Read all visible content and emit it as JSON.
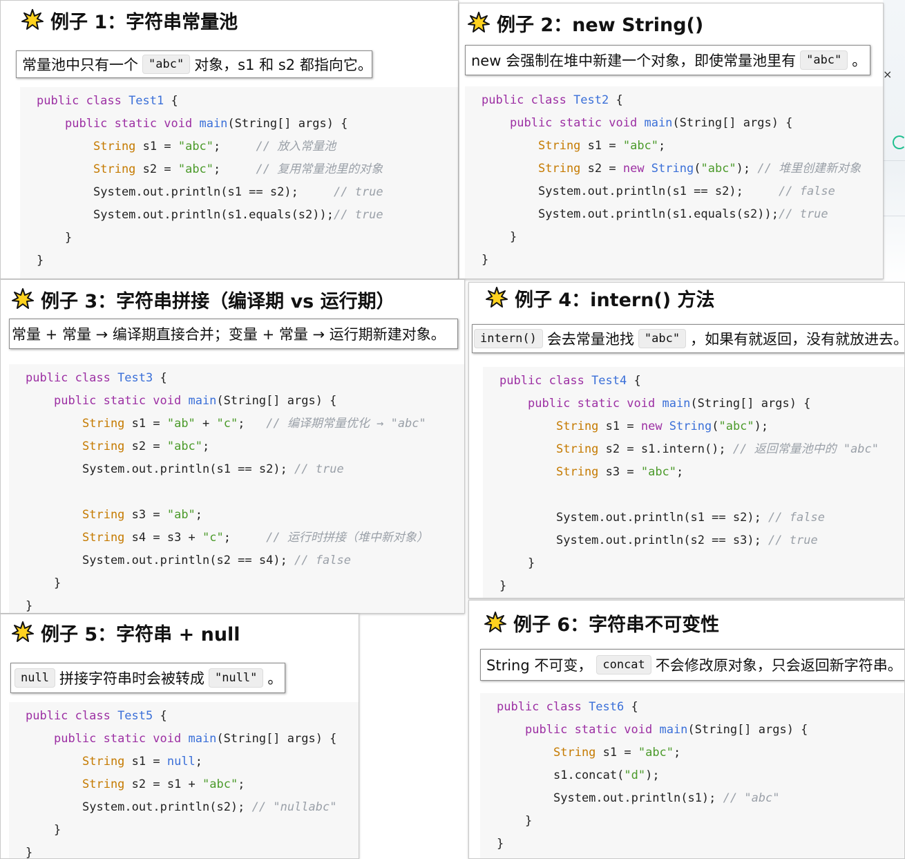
{
  "icon": "star-icon",
  "colors": {
    "keyword": "#9c2fa3",
    "type": "#c57a00",
    "function": "#3a6fd8",
    "string": "#4b9a2a",
    "comment": "#9aa0a8"
  },
  "examples": [
    {
      "title": "例子 1：字符串常量池",
      "note": {
        "pre": "常量池中只有一个",
        "chip": "\"abc\"",
        "post": "对象，s1 和 s2 都指向它。"
      },
      "code": [
        {
          "i": 0,
          "p": [
            [
              "k",
              "public class "
            ],
            [
              "f",
              "Test1"
            ],
            [
              "d",
              " {"
            ]
          ]
        },
        {
          "i": 1,
          "p": [
            [
              "k",
              "public static void "
            ],
            [
              "f",
              "main"
            ],
            [
              "d",
              "(String[] args) {"
            ]
          ]
        },
        {
          "i": 2,
          "p": [
            [
              "t",
              "String"
            ],
            [
              "d",
              " s1 = "
            ],
            [
              "s",
              "\"abc\""
            ],
            [
              "d",
              ";     "
            ],
            [
              "c",
              "// 放入常量池"
            ]
          ]
        },
        {
          "i": 2,
          "p": [
            [
              "t",
              "String"
            ],
            [
              "d",
              " s2 = "
            ],
            [
              "s",
              "\"abc\""
            ],
            [
              "d",
              ";     "
            ],
            [
              "c",
              "// 复用常量池里的对象"
            ]
          ]
        },
        {
          "i": 2,
          "p": [
            [
              "d",
              "System.out.println(s1 == s2);     "
            ],
            [
              "c",
              "// true"
            ]
          ]
        },
        {
          "i": 2,
          "p": [
            [
              "d",
              "System.out.println(s1.equals(s2));"
            ],
            [
              "c",
              "// true"
            ]
          ]
        },
        {
          "i": 1,
          "p": [
            [
              "d",
              "}"
            ]
          ]
        },
        {
          "i": 0,
          "p": [
            [
              "d",
              "}"
            ]
          ]
        }
      ]
    },
    {
      "title": "例子 2：new String()",
      "note": {
        "pre": "new 会强制在堆中新建一个对象，即使常量池里有",
        "chip": "\"abc\"",
        "post": "。"
      },
      "code": [
        {
          "i": 0,
          "p": [
            [
              "k",
              "public class "
            ],
            [
              "f",
              "Test2"
            ],
            [
              "d",
              " {"
            ]
          ]
        },
        {
          "i": 1,
          "p": [
            [
              "k",
              "public static void "
            ],
            [
              "f",
              "main"
            ],
            [
              "d",
              "(String[] args) {"
            ]
          ]
        },
        {
          "i": 2,
          "p": [
            [
              "t",
              "String"
            ],
            [
              "d",
              " s1 = "
            ],
            [
              "s",
              "\"abc\""
            ],
            [
              "d",
              ";"
            ]
          ]
        },
        {
          "i": 2,
          "p": [
            [
              "t",
              "String"
            ],
            [
              "d",
              " s2 = "
            ],
            [
              "k",
              "new "
            ],
            [
              "f",
              "String"
            ],
            [
              "d",
              "("
            ],
            [
              "s",
              "\"abc\""
            ],
            [
              "d",
              "); "
            ],
            [
              "c",
              "// 堆里创建新对象"
            ]
          ]
        },
        {
          "i": 2,
          "p": [
            [
              "d",
              "System.out.println(s1 == s2);     "
            ],
            [
              "c",
              "// false"
            ]
          ]
        },
        {
          "i": 2,
          "p": [
            [
              "d",
              "System.out.println(s1.equals(s2));"
            ],
            [
              "c",
              "// true"
            ]
          ]
        },
        {
          "i": 1,
          "p": [
            [
              "d",
              "}"
            ]
          ]
        },
        {
          "i": 0,
          "p": [
            [
              "d",
              "}"
            ]
          ]
        }
      ]
    },
    {
      "title": "例子 3：字符串拼接（编译期 vs 运行期）",
      "note": {
        "pre": "常量 + 常量 → 编译期直接合并；变量 + 常量 → 运行期新建对象。",
        "chip": "",
        "post": ""
      },
      "code": [
        {
          "i": 0,
          "p": [
            [
              "k",
              "public class "
            ],
            [
              "f",
              "Test3"
            ],
            [
              "d",
              " {"
            ]
          ]
        },
        {
          "i": 1,
          "p": [
            [
              "k",
              "public static void "
            ],
            [
              "f",
              "main"
            ],
            [
              "d",
              "(String[] args) {"
            ]
          ]
        },
        {
          "i": 2,
          "p": [
            [
              "t",
              "String"
            ],
            [
              "d",
              " s1 = "
            ],
            [
              "s",
              "\"ab\""
            ],
            [
              "d",
              " + "
            ],
            [
              "s",
              "\"c\""
            ],
            [
              "d",
              ";   "
            ],
            [
              "c",
              "// 编译期常量优化 → \"abc\""
            ]
          ]
        },
        {
          "i": 2,
          "p": [
            [
              "t",
              "String"
            ],
            [
              "d",
              " s2 = "
            ],
            [
              "s",
              "\"abc\""
            ],
            [
              "d",
              ";"
            ]
          ]
        },
        {
          "i": 2,
          "p": [
            [
              "d",
              "System.out.println(s1 == s2); "
            ],
            [
              "c",
              "// true"
            ]
          ]
        },
        {
          "i": 2,
          "p": [
            [
              "d",
              ""
            ]
          ]
        },
        {
          "i": 2,
          "p": [
            [
              "t",
              "String"
            ],
            [
              "d",
              " s3 = "
            ],
            [
              "s",
              "\"ab\""
            ],
            [
              "d",
              ";"
            ]
          ]
        },
        {
          "i": 2,
          "p": [
            [
              "t",
              "String"
            ],
            [
              "d",
              " s4 = s3 + "
            ],
            [
              "s",
              "\"c\""
            ],
            [
              "d",
              ";     "
            ],
            [
              "c",
              "// 运行时拼接（堆中新对象）"
            ]
          ]
        },
        {
          "i": 2,
          "p": [
            [
              "d",
              "System.out.println(s2 == s4); "
            ],
            [
              "c",
              "// false"
            ]
          ]
        },
        {
          "i": 1,
          "p": [
            [
              "d",
              "}"
            ]
          ]
        },
        {
          "i": 0,
          "p": [
            [
              "d",
              "}"
            ]
          ]
        }
      ]
    },
    {
      "title": "例子 4：intern() 方法",
      "note": {
        "chip0": "intern()",
        "pre": "会去常量池找",
        "chip": "\"abc\"",
        "post": "，如果有就返回，没有就放进去。"
      },
      "code": [
        {
          "i": 0,
          "p": [
            [
              "k",
              "public class "
            ],
            [
              "f",
              "Test4"
            ],
            [
              "d",
              " {"
            ]
          ]
        },
        {
          "i": 1,
          "p": [
            [
              "k",
              "public static void "
            ],
            [
              "f",
              "main"
            ],
            [
              "d",
              "(String[] args) {"
            ]
          ]
        },
        {
          "i": 2,
          "p": [
            [
              "t",
              "String"
            ],
            [
              "d",
              " s1 = "
            ],
            [
              "k",
              "new "
            ],
            [
              "f",
              "String"
            ],
            [
              "d",
              "("
            ],
            [
              "s",
              "\"abc\""
            ],
            [
              "d",
              ");"
            ]
          ]
        },
        {
          "i": 2,
          "p": [
            [
              "t",
              "String"
            ],
            [
              "d",
              " s2 = s1.intern(); "
            ],
            [
              "c",
              "// 返回常量池中的 \"abc\""
            ]
          ]
        },
        {
          "i": 2,
          "p": [
            [
              "t",
              "String"
            ],
            [
              "d",
              " s3 = "
            ],
            [
              "s",
              "\"abc\""
            ],
            [
              "d",
              ";"
            ]
          ]
        },
        {
          "i": 2,
          "p": [
            [
              "d",
              ""
            ]
          ]
        },
        {
          "i": 2,
          "p": [
            [
              "d",
              "System.out.println(s1 == s2); "
            ],
            [
              "c",
              "// false"
            ]
          ]
        },
        {
          "i": 2,
          "p": [
            [
              "d",
              "System.out.println(s2 == s3); "
            ],
            [
              "c",
              "// true"
            ]
          ]
        },
        {
          "i": 1,
          "p": [
            [
              "d",
              "}"
            ]
          ]
        },
        {
          "i": 0,
          "p": [
            [
              "d",
              "}"
            ]
          ]
        }
      ]
    },
    {
      "title": "例子 5：字符串 + null",
      "note": {
        "chip0": "null",
        "pre": "拼接字符串时会被转成",
        "chip": "\"null\"",
        "post": "。"
      },
      "code": [
        {
          "i": 0,
          "p": [
            [
              "k",
              "public class "
            ],
            [
              "f",
              "Test5"
            ],
            [
              "d",
              " {"
            ]
          ]
        },
        {
          "i": 1,
          "p": [
            [
              "k",
              "public static void "
            ],
            [
              "f",
              "main"
            ],
            [
              "d",
              "(String[] args) {"
            ]
          ]
        },
        {
          "i": 2,
          "p": [
            [
              "t",
              "String"
            ],
            [
              "d",
              " s1 = "
            ],
            [
              "f",
              "null"
            ],
            [
              "d",
              ";"
            ]
          ]
        },
        {
          "i": 2,
          "p": [
            [
              "t",
              "String"
            ],
            [
              "d",
              " s2 = s1 + "
            ],
            [
              "s",
              "\"abc\""
            ],
            [
              "d",
              ";"
            ]
          ]
        },
        {
          "i": 2,
          "p": [
            [
              "d",
              "System.out.println(s2); "
            ],
            [
              "c",
              "// \"nullabc\""
            ]
          ]
        },
        {
          "i": 1,
          "p": [
            [
              "d",
              "}"
            ]
          ]
        },
        {
          "i": 0,
          "p": [
            [
              "d",
              "}"
            ]
          ]
        }
      ]
    },
    {
      "title": "例子 6：字符串不可变性",
      "note": {
        "pre": "String 不可变，",
        "chip": "concat",
        "post": "不会修改原对象，只会返回新字符串。"
      },
      "code": [
        {
          "i": 0,
          "p": [
            [
              "k",
              "public class "
            ],
            [
              "f",
              "Test6"
            ],
            [
              "d",
              " {"
            ]
          ]
        },
        {
          "i": 1,
          "p": [
            [
              "k",
              "public static void "
            ],
            [
              "f",
              "main"
            ],
            [
              "d",
              "(String[] args) {"
            ]
          ]
        },
        {
          "i": 2,
          "p": [
            [
              "t",
              "String"
            ],
            [
              "d",
              " s1 = "
            ],
            [
              "s",
              "\"abc\""
            ],
            [
              "d",
              ";"
            ]
          ]
        },
        {
          "i": 2,
          "p": [
            [
              "d",
              "s1.concat("
            ],
            [
              "s",
              "\"d\""
            ],
            [
              "d",
              ");"
            ]
          ]
        },
        {
          "i": 2,
          "p": [
            [
              "d",
              "System.out.println(s1); "
            ],
            [
              "c",
              "// \"abc\""
            ]
          ]
        },
        {
          "i": 1,
          "p": [
            [
              "d",
              "}"
            ]
          ]
        },
        {
          "i": 0,
          "p": [
            [
              "d",
              "}"
            ]
          ]
        }
      ]
    }
  ]
}
